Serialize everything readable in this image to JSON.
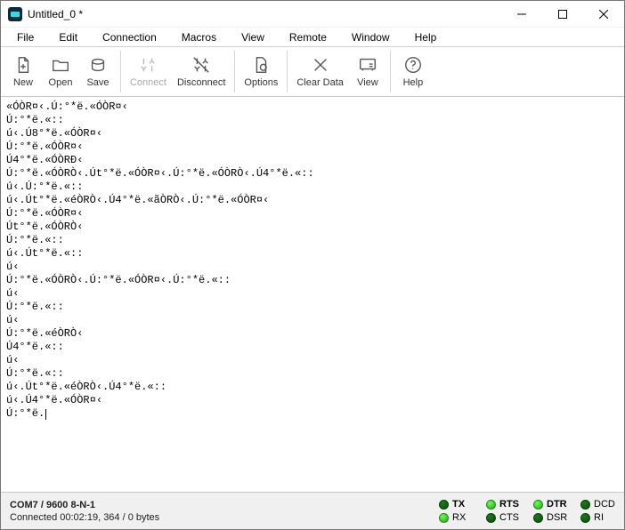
{
  "titlebar": {
    "title": "Untitled_0 *"
  },
  "menu": {
    "file": "File",
    "edit": "Edit",
    "connection": "Connection",
    "macros": "Macros",
    "view": "View",
    "remote": "Remote",
    "window": "Window",
    "help": "Help"
  },
  "toolbar": {
    "new": "New",
    "open": "Open",
    "save": "Save",
    "connect": "Connect",
    "disconnect": "Disconnect",
    "options": "Options",
    "clear_data": "Clear Data",
    "view": "View",
    "help": "Help"
  },
  "terminal": {
    "lines": [
      "«ÓÒR¤‹.Ú:°*ë.«ÓÒR¤‹",
      "Ú:°*ë.«::",
      "ú‹.Ú8°*ë.«ÓÒR¤‹",
      "Ú:°*ë.«ÓÒR¤‹",
      "Ú4°*ë.«ÓÒRÐ‹",
      "Ú:°*ë.«ÓÒRÒ‹.Út°*ë.«ÓÒR¤‹.Ú:°*ë.«ÓÒRÒ‹.Ú4°*ë.«::",
      "ú‹.Ú:°*ë.«::",
      "ú‹.Út°*ë.«éÒRÒ‹.Ú4°*ë.«ãÒRÒ‹.Ú:°*ë.«ÓÒR¤‹",
      "Ú:°*ë.«ÓÒR¤‹",
      "Út°*ë.«ÓÒRÒ‹",
      "Ú:°*ë.«::",
      "ú‹.Út°*ë.«::",
      "ú‹",
      "Ú:°*ë.«ÓÒRÒ‹.Ú:°*ë.«ÓÒR¤‹.Ú:°*ë.«::",
      "ú‹",
      "Ú:°*ë.«::",
      "ú‹",
      "Ú:°*ë.«éÒRÒ‹",
      "Ú4°*ë.«::",
      "ú‹",
      "Ú:°*ë.«::",
      "ú‹.Út°*ë.«éÒRÒ‹.Ú4°*ë.«::",
      "ú‹.Ú4°*ë.«ÓÒR¤‹",
      "Ú:°*ë."
    ]
  },
  "status": {
    "port": "COM7 / 9600 8-N-1",
    "connected": "Connected 00:02:19, 364 / 0 bytes",
    "leds": {
      "tx": {
        "label": "TX",
        "bold": true,
        "state": "dark"
      },
      "rx": {
        "label": "RX",
        "bold": false,
        "state": "bright"
      },
      "rts": {
        "label": "RTS",
        "bold": true,
        "state": "bright"
      },
      "cts": {
        "label": "CTS",
        "bold": false,
        "state": "dark"
      },
      "dtr": {
        "label": "DTR",
        "bold": true,
        "state": "bright"
      },
      "dsr": {
        "label": "DSR",
        "bold": false,
        "state": "dark"
      },
      "dcd": {
        "label": "DCD",
        "bold": false,
        "state": "dark"
      },
      "ri": {
        "label": "RI",
        "bold": false,
        "state": "dark"
      }
    }
  }
}
